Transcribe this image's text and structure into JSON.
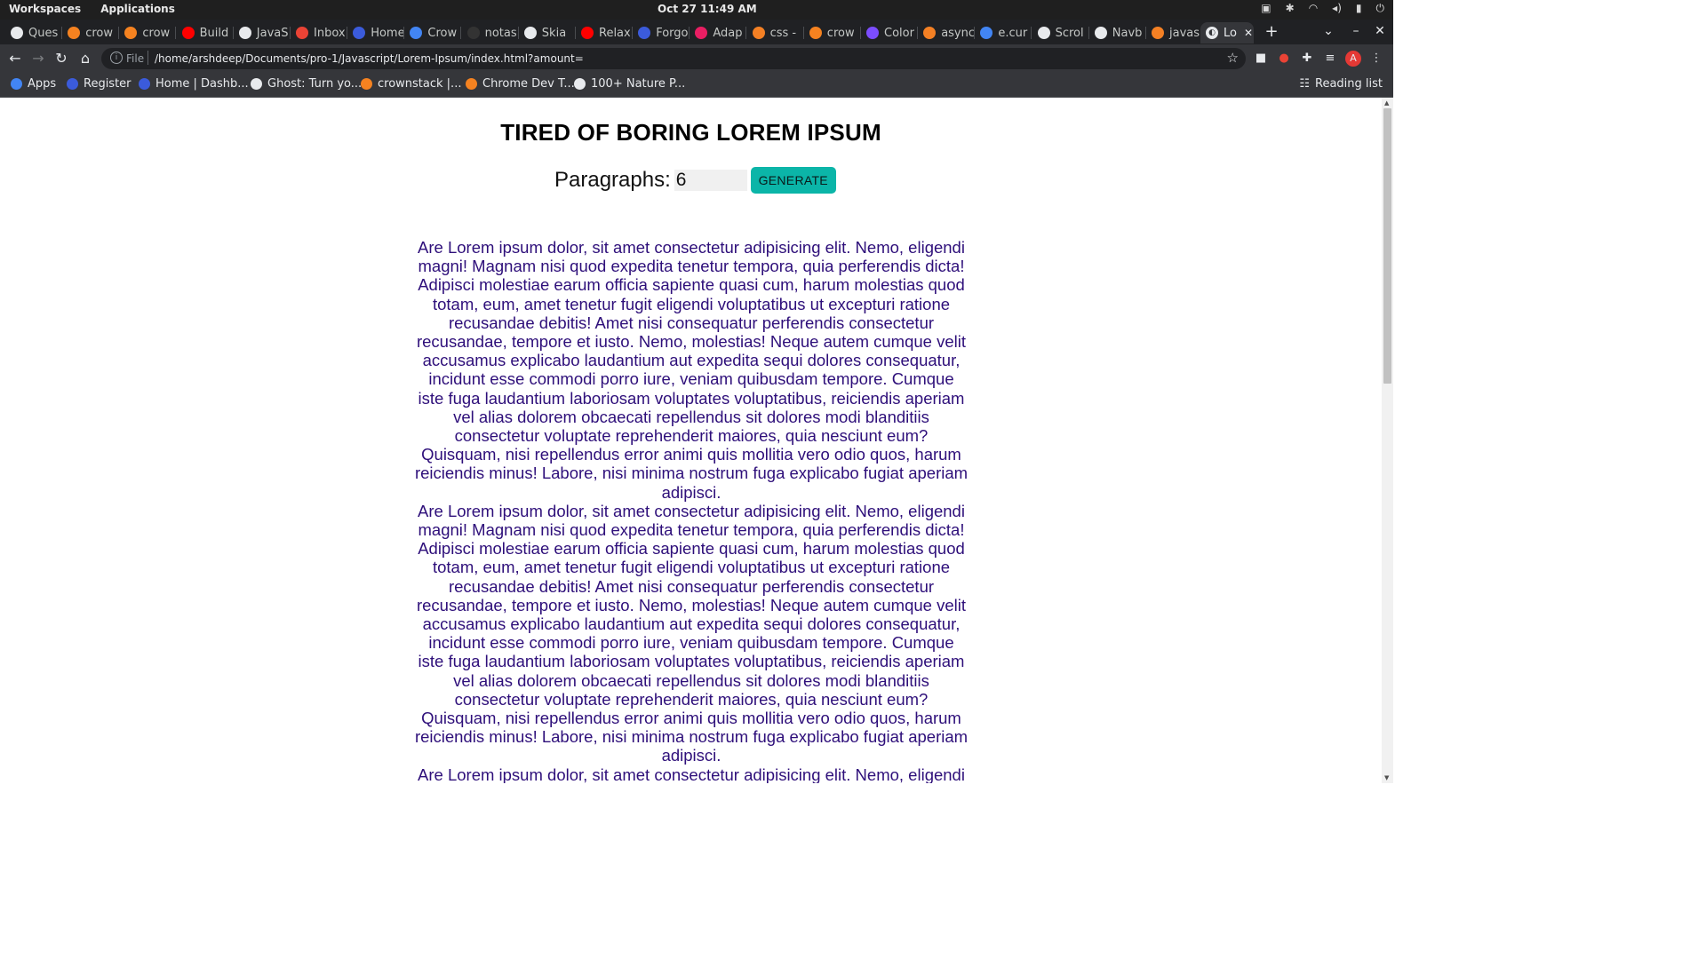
{
  "os": {
    "workspaces": "Workspaces",
    "applications": "Applications",
    "clock": "Oct 27  11:49 AM"
  },
  "tabs": [
    {
      "label": "Ques",
      "color": "#e8eaed"
    },
    {
      "label": "crow",
      "color": "#f58220"
    },
    {
      "label": "crow",
      "color": "#f58220"
    },
    {
      "label": "Build",
      "color": "#ff0000"
    },
    {
      "label": "JavaS",
      "color": "#e8eaed"
    },
    {
      "label": "Inbox",
      "color": "#ea4335"
    },
    {
      "label": "Home",
      "color": "#3b5bdb"
    },
    {
      "label": "Crow",
      "color": "#4285f4"
    },
    {
      "label": "notas",
      "color": "#333333"
    },
    {
      "label": "Skia",
      "color": "#e8eaed"
    },
    {
      "label": "Relax",
      "color": "#ff0000"
    },
    {
      "label": "Forgo",
      "color": "#3b5bdb"
    },
    {
      "label": "Adap",
      "color": "#e91e63"
    },
    {
      "label": "css -",
      "color": "#f48024"
    },
    {
      "label": "crow",
      "color": "#f58220"
    },
    {
      "label": "Color",
      "color": "#7c4dff"
    },
    {
      "label": "async",
      "color": "#f48024"
    },
    {
      "label": "e.cur",
      "color": "#4285f4"
    },
    {
      "label": "Scrol",
      "color": "#e8eaed"
    },
    {
      "label": "Navb",
      "color": "#e8eaed"
    },
    {
      "label": "javas",
      "color": "#f48024"
    }
  ],
  "active_tab": {
    "label": "Lo"
  },
  "address": {
    "scheme": "File",
    "url": "/home/arshdeep/Documents/pro-1/Javascript/Lorem-Ipsum/index.html?amount="
  },
  "bookmarks": [
    {
      "label": "Apps",
      "color": "#4285f4"
    },
    {
      "label": "Register",
      "color": "#3b5bdb"
    },
    {
      "label": "Home | Dashb...",
      "color": "#3b5bdb"
    },
    {
      "label": "Ghost: Turn yo...",
      "color": "#e8eaed"
    },
    {
      "label": "crownstack |...",
      "color": "#f58220"
    },
    {
      "label": "Chrome Dev T...",
      "color": "#f58220"
    },
    {
      "label": "100+ Nature P...",
      "color": "#e8eaed"
    }
  ],
  "reading_list": "Reading list",
  "profile_initial": "A",
  "page": {
    "title": "TIRED OF BORING LOREM IPSUM",
    "amount_label": "Paragraphs:",
    "amount_value": "6",
    "generate_label": "GENERATE",
    "paragraphs": [
      "Are Lorem ipsum dolor, sit amet consectetur adipisicing elit. Nemo, eligendi magni! Magnam nisi quod expedita tenetur tempora, quia perferendis dicta! Adipisci molestiae earum officia sapiente quasi cum, harum molestias quod totam, eum, amet tenetur fugit eligendi voluptatibus ut excepturi ratione recusandae debitis! Amet nisi consequatur perferendis consectetur recusandae, tempore et iusto. Nemo, molestias! Neque autem cumque velit accusamus explicabo laudantium aut expedita sequi dolores consequatur, incidunt esse commodi porro iure, veniam quibusdam tempore. Cumque iste fuga laudantium laboriosam voluptates voluptatibus, reiciendis aperiam vel alias dolorem obcaecati repellendus sit dolores modi blanditiis consectetur voluptate reprehenderit maiores, quia nesciunt eum? Quisquam, nisi repellendus error animi quis mollitia vero odio quos, harum reiciendis minus! Labore, nisi minima nostrum fuga explicabo fugiat aperiam adipisci.",
      "Are Lorem ipsum dolor, sit amet consectetur adipisicing elit. Nemo, eligendi magni! Magnam nisi quod expedita tenetur tempora, quia perferendis dicta! Adipisci molestiae earum officia sapiente quasi cum, harum molestias quod totam, eum, amet tenetur fugit eligendi voluptatibus ut excepturi ratione recusandae debitis! Amet nisi consequatur perferendis consectetur recusandae, tempore et iusto. Nemo, molestias! Neque autem cumque velit accusamus explicabo laudantium aut expedita sequi dolores consequatur, incidunt esse commodi porro iure, veniam quibusdam tempore. Cumque iste fuga laudantium laboriosam voluptates voluptatibus, reiciendis aperiam vel alias dolorem obcaecati repellendus sit dolores modi blanditiis consectetur voluptate reprehenderit maiores, quia nesciunt eum? Quisquam, nisi repellendus error animi quis mollitia vero odio quos, harum reiciendis minus! Labore, nisi minima nostrum fuga explicabo fugiat aperiam adipisci.",
      "Are Lorem ipsum dolor, sit amet consectetur adipisicing elit. Nemo, eligendi magni! Magnam nisi quod expedita tenetur tempora, quia perferendis dicta! Adipisci molestiae earum officia sapiente quasi cum, harum molestias quod totam, eum, amet tenetur fugit eligendi voluptatibus ut excepturi ratione recusandae debitis!"
    ]
  },
  "colors": {
    "accent_button": "#0bb5a8",
    "paragraph_text": "#2e0f7a"
  }
}
